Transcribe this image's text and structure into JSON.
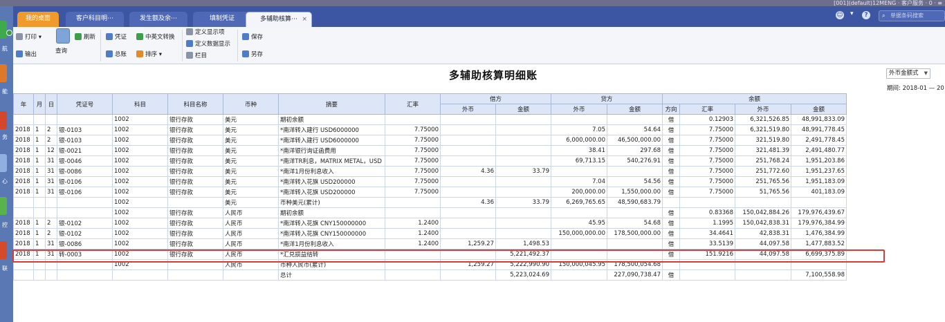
{
  "topbar": {
    "system_info": "[001](default)12MENG · 客户服务 · 0 · ≡"
  },
  "leftrail": {
    "labels": [
      "航",
      "能",
      "务",
      "心",
      "控",
      "联"
    ]
  },
  "tabs": {
    "home": "我的桌面",
    "t2": "客户科目明⋯",
    "t3": "发生额及余⋯",
    "t4": "填制凭证",
    "active": "多辅助核算⋯",
    "close": "×"
  },
  "search": {
    "placeholder": "单据条码搜索"
  },
  "toolbar": {
    "print": "打印",
    "export": "输出",
    "query": "查询",
    "refresh": "刷新",
    "voucher": "凭证",
    "ledger": "总账",
    "translate": "中英文转换",
    "sort": "排序",
    "define_display": "定义显示项",
    "define_data_display": "定义数据显示",
    "column": "栏目",
    "save": "保存",
    "save_as": "另存"
  },
  "report": {
    "title": "多辅助核算明细账",
    "format": "外币金额式",
    "period": "期间: 2018-01 — 20"
  },
  "table": {
    "headers": {
      "year": "年",
      "month": "月",
      "day": "日",
      "voucher": "凭证号",
      "subject": "科目",
      "subject_name": "科目名称",
      "currency": "币种",
      "summary": "摘要",
      "rate": "汇率",
      "debit": "借方",
      "credit": "贷方",
      "balance": "余额",
      "fc": "外币",
      "amount": "金额",
      "direction": "方向",
      "bal_rate": "汇率",
      "bal_fc": "外币",
      "bal_amount": "金额"
    },
    "rows": [
      [
        "",
        "",
        "",
        "",
        "1002",
        "银行存款",
        "美元",
        "期初余额",
        "",
        "",
        "",
        "",
        "",
        "借",
        "0.12903",
        "6,321,526.85",
        "48,991,833.09"
      ],
      [
        "2018",
        "1",
        "2",
        "银-0103",
        "1002",
        "银行存款",
        "美元",
        "*南洋转入建行 USD6000000",
        "7.75000",
        "",
        "",
        "7.05",
        "54.64",
        "借",
        "7.75000",
        "6,321,519.80",
        "48,991,778.45"
      ],
      [
        "2018",
        "1",
        "2",
        "银-0103",
        "1002",
        "银行存款",
        "美元",
        "*南洋转入建行 USD6000000",
        "7.75000",
        "",
        "",
        "6,000,000.00",
        "46,500,000.00",
        "借",
        "7.75000",
        "321,519.80",
        "2,491,778.45"
      ],
      [
        "2018",
        "1",
        "12",
        "银-0021",
        "1002",
        "银行存款",
        "美元",
        "*南洋银行询证函费用",
        "7.75000",
        "",
        "",
        "38.41",
        "297.68",
        "借",
        "7.75000",
        "321,481.39",
        "2,491,480.77"
      ],
      [
        "2018",
        "1",
        "31",
        "银-0046",
        "1002",
        "银行存款",
        "美元",
        "*南洋TR利息，MATRIX METAL，USD",
        "7.75000",
        "",
        "",
        "69,713.15",
        "540,276.91",
        "借",
        "7.75000",
        "251,768.24",
        "1,951,203.86"
      ],
      [
        "2018",
        "1",
        "31",
        "银-0086",
        "1002",
        "银行存款",
        "美元",
        "*南洋1月份利息收入",
        "7.75000",
        "4.36",
        "33.79",
        "",
        "",
        "借",
        "7.75000",
        "251,772.60",
        "1,951,237.65"
      ],
      [
        "2018",
        "1",
        "31",
        "银-0106",
        "1002",
        "银行存款",
        "美元",
        "*南洋转入花旗 USD200000",
        "7.75000",
        "",
        "",
        "7.04",
        "54.56",
        "借",
        "7.75000",
        "251,765.56",
        "1,951,183.09"
      ],
      [
        "2018",
        "1",
        "31",
        "银-0106",
        "1002",
        "银行存款",
        "美元",
        "*南洋转入花旗 USD200000",
        "7.75000",
        "",
        "",
        "200,000.00",
        "1,550,000.00",
        "借",
        "7.75000",
        "51,765.56",
        "401,183.09"
      ],
      [
        "",
        "",
        "",
        "",
        "1002",
        "",
        "美元",
        "币种美元(累计)",
        "",
        "4.36",
        "33.79",
        "6,269,765.65",
        "48,590,683.79",
        "",
        "",
        "",
        ""
      ],
      [
        "",
        "",
        "",
        "",
        "1002",
        "银行存款",
        "人民币",
        "期初余额",
        "",
        "",
        "",
        "",
        "",
        "借",
        "0.83368",
        "150,042,884.26",
        "179,976,439.67"
      ],
      [
        "2018",
        "1",
        "2",
        "银-0102",
        "1002",
        "银行存款",
        "人民币",
        "*南洋转入花旗 CNY150000000",
        "1.2400",
        "",
        "",
        "45.95",
        "54.68",
        "借",
        "1.1995",
        "150,042,838.31",
        "179,976,384.99"
      ],
      [
        "2018",
        "1",
        "2",
        "银-0102",
        "1002",
        "银行存款",
        "人民币",
        "*南洋转入花旗 CNY150000000",
        "1.2400",
        "",
        "",
        "150,000,000.00",
        "178,500,000.00",
        "借",
        "34.4641",
        "42,838.31",
        "1,476,384.99"
      ],
      [
        "2018",
        "1",
        "31",
        "银-0086",
        "1002",
        "银行存款",
        "人民币",
        "*南洋1月份利息收入",
        "1.2400",
        "1,259.27",
        "1,498.53",
        "",
        "",
        "借",
        "33.5139",
        "44,097.58",
        "1,477,883.52"
      ],
      [
        "2018",
        "1",
        "31",
        "转-0003",
        "1002",
        "银行存款",
        "人民币",
        "*汇兑损益结转",
        "",
        "",
        "5,221,492.37",
        "",
        "",
        "借",
        "151.9216",
        "44,097.58",
        "6,699,375.89"
      ],
      [
        "",
        "",
        "",
        "",
        "1002",
        "",
        "人民币",
        "币种人民币(累计)",
        "",
        "1,259.27",
        "5,222,990.90",
        "150,000,045.95",
        "178,500,054.68",
        "",
        "",
        "",
        ""
      ],
      [
        "",
        "",
        "",
        "",
        "",
        "",
        "",
        "总计",
        "",
        "",
        "5,223,024.69",
        "",
        "227,090,738.47",
        "借",
        "",
        "",
        "7,100,558.98"
      ]
    ]
  }
}
